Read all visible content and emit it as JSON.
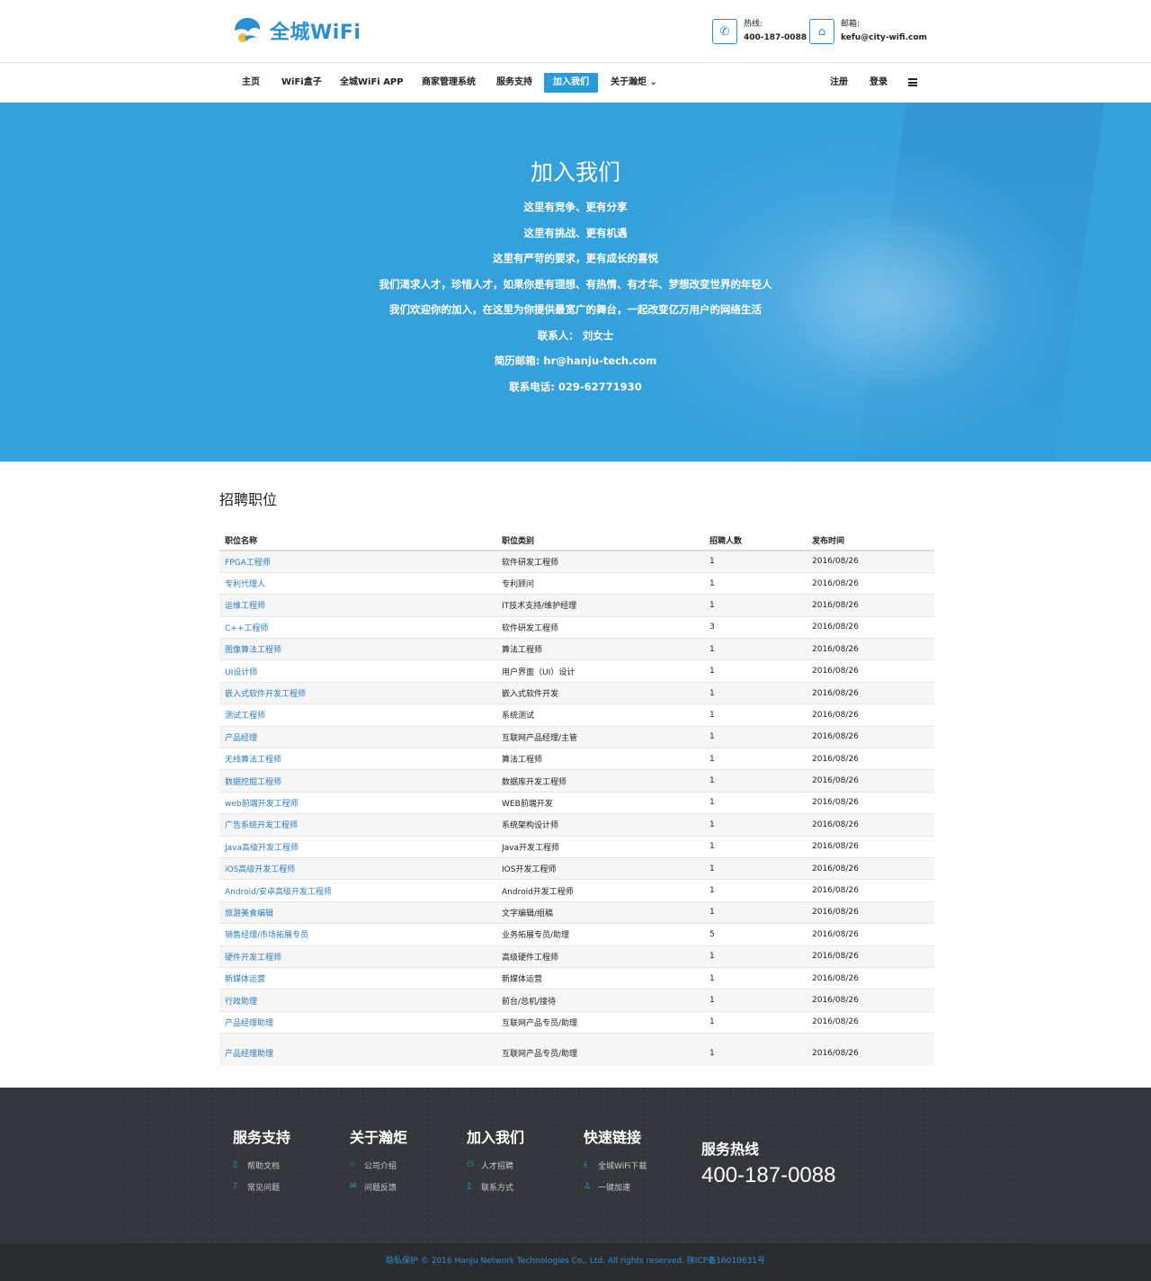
{
  "header": {
    "logo_text": "全城WiFi",
    "hotline_label": "热线:",
    "hotline_value": "400-187-0088",
    "email_label": "邮箱:",
    "email_value": "kefu@city-wifi.com"
  },
  "nav": {
    "items": [
      {
        "label": "主页"
      },
      {
        "label": "WiFi盒子"
      },
      {
        "label": "全城WiFi APP"
      },
      {
        "label": "商家管理系统"
      },
      {
        "label": "服务支持"
      },
      {
        "label": "加入我们",
        "active": true
      },
      {
        "label": "关于瀚炬 ⌄"
      }
    ],
    "register": "注册",
    "login": "登录"
  },
  "hero": {
    "title": "加入我们",
    "lines": [
      "这里有竞争、更有分享",
      "这里有挑战、更有机遇",
      "这里有严苛的要求，更有成长的喜悦",
      "我们渴求人才，珍惜人才，如果你是有理想、有热情、有才华、梦想改变世界的年轻人",
      "我们欢迎你的加入，在这里为你提供最宽广的舞台，一起改变亿万用户的网络生活",
      "联系人：  刘女士",
      "简历邮箱: hr@hanju-tech.com",
      "联系电话:   029-62771930"
    ]
  },
  "jobs": {
    "title": "招聘职位",
    "columns": [
      "职位名称",
      "职位类别",
      "招聘人数",
      "发布时间"
    ],
    "rows": [
      [
        "FPGA工程师",
        "软件研发工程师",
        "1",
        "2016/08/26"
      ],
      [
        "专利代理人",
        "专利顾问",
        "1",
        "2016/08/26"
      ],
      [
        "运维工程师",
        "IT技术支持/维护经理",
        "1",
        "2016/08/26"
      ],
      [
        "C++工程师",
        "软件研发工程师",
        "3",
        "2016/08/26"
      ],
      [
        "图像算法工程师",
        "算法工程师",
        "1",
        "2016/08/26"
      ],
      [
        "UI设计师",
        "用户界面（UI）设计",
        "1",
        "2016/08/26"
      ],
      [
        "嵌入式软件开发工程师",
        "嵌入式软件开发",
        "1",
        "2016/08/26"
      ],
      [
        "测试工程师",
        "系统测试",
        "1",
        "2016/08/26"
      ],
      [
        "产品经理",
        "互联网产品经理/主管",
        "1",
        "2016/08/26"
      ],
      [
        "无线算法工程师",
        "算法工程师",
        "1",
        "2016/08/26"
      ],
      [
        "数据挖掘工程师",
        "数据库开发工程师",
        "1",
        "2016/08/26"
      ],
      [
        "web前端开发工程师",
        "WEB前端开发",
        "1",
        "2016/08/26"
      ],
      [
        "广告系统开发工程师",
        "系统架构设计师",
        "1",
        "2016/08/26"
      ],
      [
        "Java高级开发工程师",
        "Java开发工程师",
        "1",
        "2016/08/26"
      ],
      [
        "iOS高级开发工程师",
        "IOS开发工程师",
        "1",
        "2016/08/26"
      ],
      [
        "Android/安卓高级开发工程师",
        "Android开发工程师",
        "1",
        "2016/08/26"
      ],
      [
        "旅游美食编辑",
        "文字编辑/组稿",
        "1",
        "2016/08/26"
      ],
      [
        "销售经理/市场拓展专员",
        "业务拓展专员/助理",
        "5",
        "2016/08/26"
      ],
      [
        "硬件开发工程师",
        "高级硬件工程师",
        "1",
        "2016/08/26"
      ],
      [
        "新媒体运营",
        "新媒体运营",
        "1",
        "2016/08/26"
      ],
      [
        "行政助理",
        "前台/总机/接待",
        "1",
        "2016/08/26"
      ],
      [
        "产品经理助理",
        "互联网产品专员/助理",
        "1",
        "2016/08/26"
      ],
      [
        "产品经理助理",
        "互联网产品专员/助理",
        "1",
        "2016/08/26"
      ]
    ]
  },
  "footer": {
    "columns": [
      {
        "title": "服务支持",
        "links": [
          {
            "icon": "book-icon",
            "glyph": "▯",
            "label": "帮助文档"
          },
          {
            "icon": "question-icon",
            "glyph": "?",
            "label": "常见问题"
          }
        ]
      },
      {
        "title": "关于瀚炬",
        "links": [
          {
            "icon": "thumbs-up-icon",
            "glyph": "☝",
            "label": "公司介绍"
          },
          {
            "icon": "mail-icon",
            "glyph": "✉",
            "label": "问题反馈"
          }
        ]
      },
      {
        "title": "加入我们",
        "links": [
          {
            "icon": "user-icon",
            "glyph": "⚇",
            "label": "人才招聘"
          },
          {
            "icon": "phone-icon",
            "glyph": "▯",
            "label": "联系方式"
          }
        ]
      },
      {
        "title": "快速链接",
        "links": [
          {
            "icon": "download-icon",
            "glyph": "⤓",
            "label": "全城WiFi下载"
          },
          {
            "icon": "person-icon",
            "glyph": "♙",
            "label": "一键加速"
          }
        ]
      }
    ],
    "hotline_title": "服务热线",
    "hotline_number": "400-187-0088",
    "copyright": "隐私保护 © 2016 Hanju Network Technologies Co., Ltd. All rights reserved. 陕ICP备16010631号"
  },
  "colors": {
    "brand_blue": "#2b9ad8",
    "hero_blue": "#35a1dc",
    "footer_bg": "#33373b",
    "link_blue": "#2b7bc0"
  }
}
